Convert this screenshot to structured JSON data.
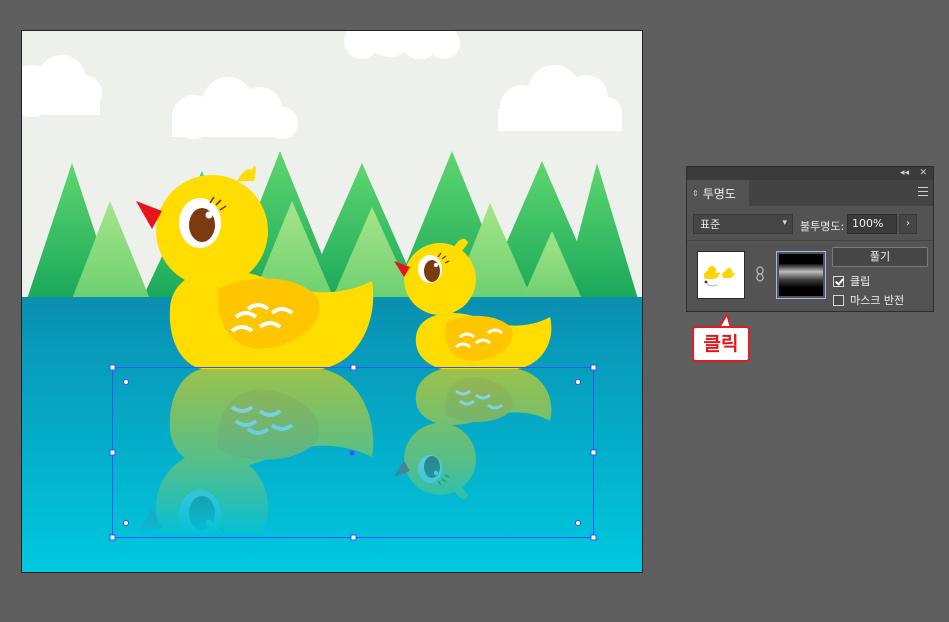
{
  "panel": {
    "title": "투명도",
    "blend_mode": "표준",
    "opacity_label": "불투명도:",
    "opacity_value": "100%",
    "release_button": "풀기",
    "clip_label": "클립",
    "clip_checked": true,
    "invert_mask_label": "마스크 반전",
    "invert_mask_checked": false,
    "collapse_glyph": "◂◂",
    "close_glyph": "✕"
  },
  "callout": {
    "text": "클릭",
    "color": "#e0181b"
  },
  "colors": {
    "workspace": "#5f5f5f",
    "sky": "#eef0ec",
    "duck_yellow": "#ffdd00",
    "wing": "#ffc600",
    "beak": "#e8141c",
    "selection": "#3355ff"
  },
  "icons": [
    "updown-arrows-icon",
    "panel-menu-icon",
    "chevron-down-icon",
    "chevron-right-icon",
    "chain-link-icon",
    "checkbox-icon"
  ]
}
